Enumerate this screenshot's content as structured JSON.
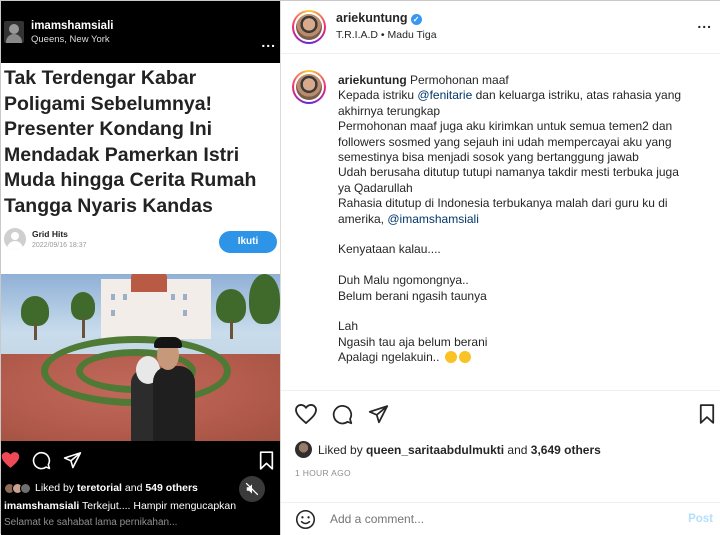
{
  "left_post": {
    "username": "imamshamsiali",
    "location": "Queens, New York",
    "more": "...",
    "article": {
      "title": "Tak Terdengar Kabar Poligami Sebelumnya! Presenter Kondang Ini Mendadak Pamerkan Istri Muda hingga Cerita Rumah Tangga Nyaris Kandas",
      "source_name": "Grid Hits",
      "date": "2022/09/16 18:37",
      "follow_label": "Ikuti"
    },
    "likes_prefix": "Liked by",
    "likes_user": "teretorial",
    "likes_and": "and",
    "likes_count": "549 others",
    "caption_user": "imamshamsiali",
    "caption_text": "Terkejut.... Hampir mengucapkan",
    "caption_cut": "Selamat ke sahabat lama pernikahan..."
  },
  "right_post": {
    "header": {
      "username": "ariekuntung",
      "subtitle": "T.R.I.A.D • Madu Tiga",
      "more": "..."
    },
    "comment": {
      "username": "ariekuntung",
      "line1": " Permohonan maaf",
      "line2a": "Kepada istriku ",
      "mention1": "@fenitarie",
      "line2b": " dan keluarga istriku, atas rahasia yang",
      "line3": "akhirnya terungkap",
      "line4": "Permohonan maaf juga aku kirimkan untuk semua temen2 dan",
      "line5": "followers sosmed yang sejauh ini udah mempercayai aku yang",
      "line6": "semestinya bisa menjadi sosok yang bertanggung jawab",
      "line7": "Udah berusaha ditutup tutupi namanya takdir mesti terbuka juga",
      "line8": "ya Qadarullah",
      "line9": "Rahasia ditutup di Indonesia terbukanya malah dari guru ku di",
      "line10a": "amerika, ",
      "mention2": "@imamshamsiali",
      "line11": "Kenyataan kalau....",
      "line12": "Duh Malu ngomongnya..",
      "line13": "Belum berani ngasih taunya",
      "line14": "Lah",
      "line15": "Ngasih tau aja belum berani",
      "line16": "Apalagi ngelakuin.."
    },
    "liked_prefix": "Liked by ",
    "liked_user": "queen_saritaabdulmukti",
    "liked_and": " and ",
    "liked_count": "3,649 others",
    "time": "1 HOUR AGO",
    "add_comment_placeholder": "Add a comment...",
    "post_label": "Post"
  },
  "colors": {
    "follow_button": "#2e94e8",
    "verified_badge": "#3897f0",
    "mention": "#00376b",
    "like_heart": "#ed4956",
    "post_disabled": "#b2dffc"
  },
  "icons": [
    "heart-icon",
    "comment-icon",
    "share-icon",
    "bookmark-icon",
    "mute-icon",
    "emoji-icon",
    "verified-icon"
  ]
}
